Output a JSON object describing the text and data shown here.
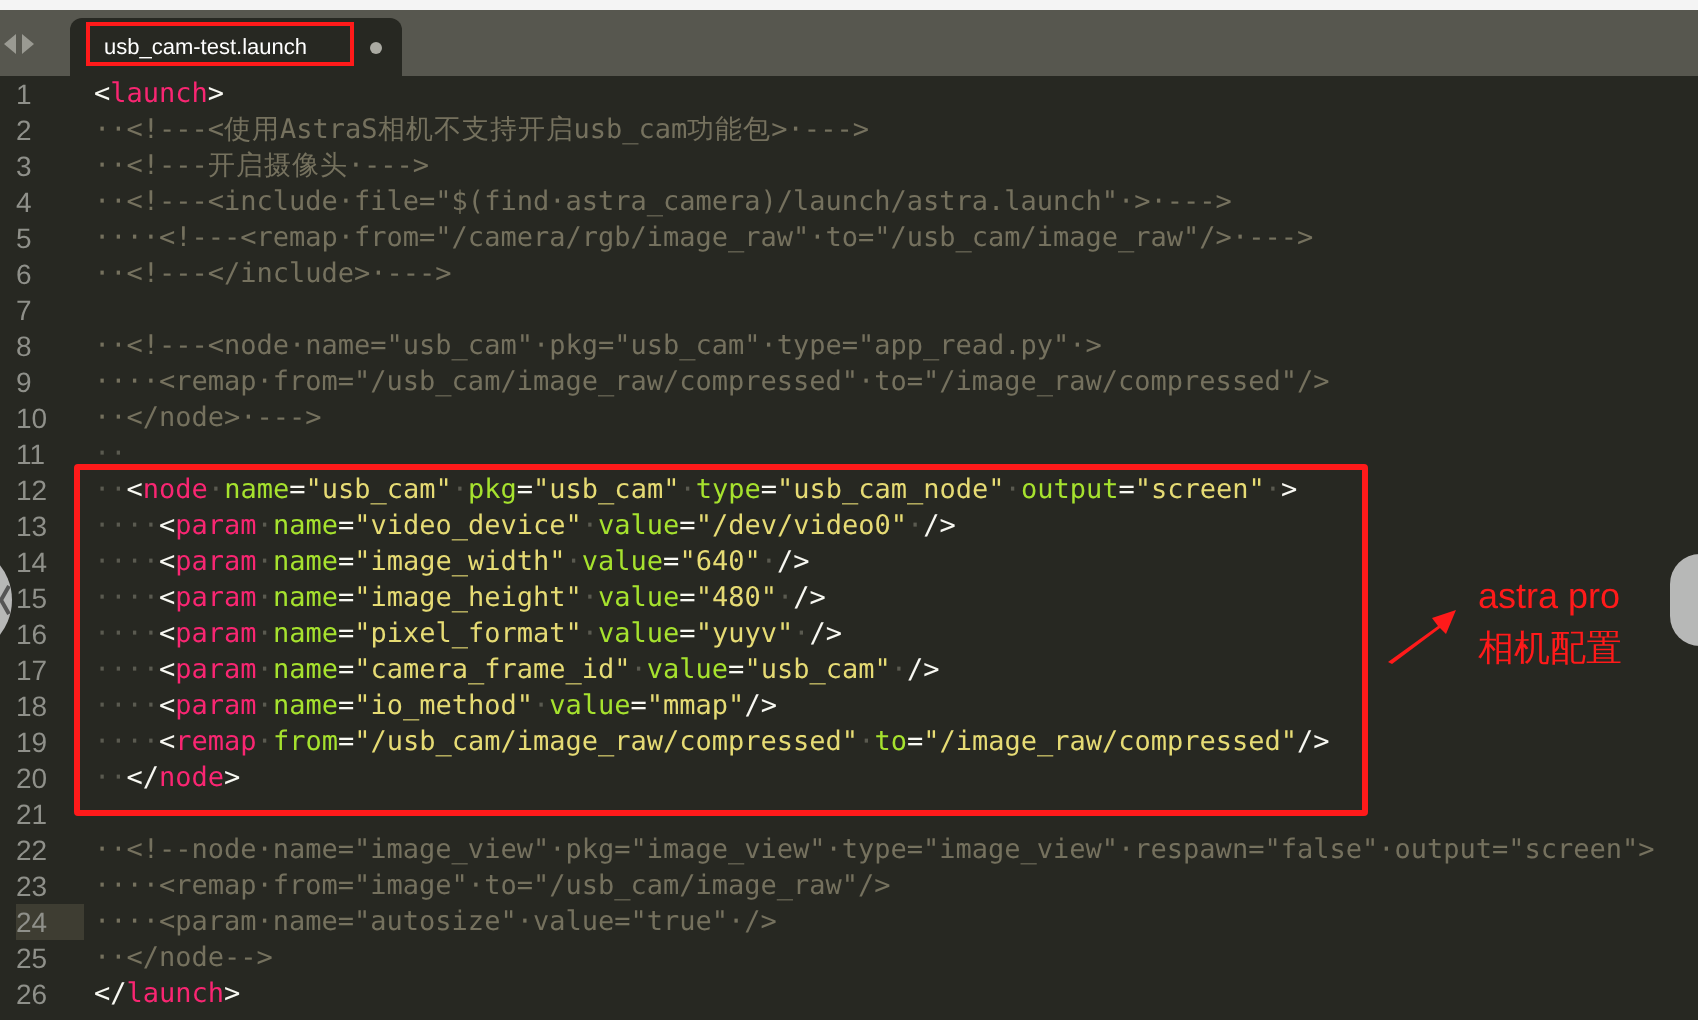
{
  "tab": {
    "label": "usb_cam-test.launch"
  },
  "lines": [
    {
      "number": "1",
      "current": false,
      "tokens": [
        {
          "kind": "punct",
          "text": "<"
        },
        {
          "kind": "tag",
          "text": "launch"
        },
        {
          "kind": "punct",
          "text": ">"
        }
      ]
    },
    {
      "number": "2",
      "current": false,
      "tokens": [
        {
          "kind": "comment",
          "text": "··<!---<使用AstraS相机不支持开启usb_cam功能包>·--->"
        }
      ]
    },
    {
      "number": "3",
      "current": false,
      "tokens": [
        {
          "kind": "comment",
          "text": "··<!---开启摄像头·--->"
        }
      ]
    },
    {
      "number": "4",
      "current": false,
      "tokens": [
        {
          "kind": "comment",
          "text": "··<!---<include·file=\"$(find·astra_camera)/launch/astra.launch\"·>·--->"
        }
      ]
    },
    {
      "number": "5",
      "current": false,
      "tokens": [
        {
          "kind": "comment",
          "text": "····<!---<remap·from=\"/camera/rgb/image_raw\"·to=\"/usb_cam/image_raw\"/>·--->"
        }
      ]
    },
    {
      "number": "6",
      "current": false,
      "tokens": [
        {
          "kind": "comment",
          "text": "··<!---</include>·--->"
        }
      ]
    },
    {
      "number": "7",
      "current": false
    },
    {
      "number": "8",
      "current": false,
      "tokens": [
        {
          "kind": "comment",
          "text": "··<!---<node·name=\"usb_cam\"·pkg=\"usb_cam\"·type=\"app_read.py\"·>"
        }
      ]
    },
    {
      "number": "9",
      "current": false,
      "tokens": [
        {
          "kind": "comment",
          "text": "····<remap·from=\"/usb_cam/image_raw/compressed\"·to=\"/image_raw/compressed\"/>"
        }
      ]
    },
    {
      "number": "10",
      "current": false,
      "tokens": [
        {
          "kind": "comment",
          "text": "··</node>·--->"
        }
      ]
    },
    {
      "number": "11",
      "current": false,
      "tokens": [
        {
          "kind": "space",
          "text": "··"
        }
      ]
    },
    {
      "number": "12",
      "current": false,
      "tokens": [
        {
          "kind": "space",
          "text": "··"
        },
        {
          "kind": "punct",
          "text": "<"
        },
        {
          "kind": "tag",
          "text": "node"
        },
        {
          "kind": "space",
          "text": "·"
        },
        {
          "kind": "attr",
          "text": "name"
        },
        {
          "kind": "punct",
          "text": "="
        },
        {
          "kind": "string",
          "text": "\"usb_cam\""
        },
        {
          "kind": "space",
          "text": "·"
        },
        {
          "kind": "attr",
          "text": "pkg"
        },
        {
          "kind": "punct",
          "text": "="
        },
        {
          "kind": "string",
          "text": "\"usb_cam\""
        },
        {
          "kind": "space",
          "text": "·"
        },
        {
          "kind": "attr",
          "text": "type"
        },
        {
          "kind": "punct",
          "text": "="
        },
        {
          "kind": "string",
          "text": "\"usb_cam_node\""
        },
        {
          "kind": "space",
          "text": "·"
        },
        {
          "kind": "attr",
          "text": "output"
        },
        {
          "kind": "punct",
          "text": "="
        },
        {
          "kind": "string",
          "text": "\"screen\""
        },
        {
          "kind": "space",
          "text": "·"
        },
        {
          "kind": "punct",
          "text": ">"
        }
      ]
    },
    {
      "number": "13",
      "current": false,
      "tokens": [
        {
          "kind": "space",
          "text": "····"
        },
        {
          "kind": "punct",
          "text": "<"
        },
        {
          "kind": "tag",
          "text": "param"
        },
        {
          "kind": "space",
          "text": "·"
        },
        {
          "kind": "attr",
          "text": "name"
        },
        {
          "kind": "punct",
          "text": "="
        },
        {
          "kind": "string",
          "text": "\"video_device\""
        },
        {
          "kind": "space",
          "text": "·"
        },
        {
          "kind": "attr",
          "text": "value"
        },
        {
          "kind": "punct",
          "text": "="
        },
        {
          "kind": "string",
          "text": "\"/dev/video0\""
        },
        {
          "kind": "space",
          "text": "·"
        },
        {
          "kind": "punct",
          "text": "/>"
        }
      ]
    },
    {
      "number": "14",
      "current": false,
      "tokens": [
        {
          "kind": "space",
          "text": "····"
        },
        {
          "kind": "punct",
          "text": "<"
        },
        {
          "kind": "tag",
          "text": "param"
        },
        {
          "kind": "space",
          "text": "·"
        },
        {
          "kind": "attr",
          "text": "name"
        },
        {
          "kind": "punct",
          "text": "="
        },
        {
          "kind": "string",
          "text": "\"image_width\""
        },
        {
          "kind": "space",
          "text": "·"
        },
        {
          "kind": "attr",
          "text": "value"
        },
        {
          "kind": "punct",
          "text": "="
        },
        {
          "kind": "string",
          "text": "\"640\""
        },
        {
          "kind": "space",
          "text": "·"
        },
        {
          "kind": "punct",
          "text": "/>"
        }
      ]
    },
    {
      "number": "15",
      "current": false,
      "tokens": [
        {
          "kind": "space",
          "text": "····"
        },
        {
          "kind": "punct",
          "text": "<"
        },
        {
          "kind": "tag",
          "text": "param"
        },
        {
          "kind": "space",
          "text": "·"
        },
        {
          "kind": "attr",
          "text": "name"
        },
        {
          "kind": "punct",
          "text": "="
        },
        {
          "kind": "string",
          "text": "\"image_height\""
        },
        {
          "kind": "space",
          "text": "·"
        },
        {
          "kind": "attr",
          "text": "value"
        },
        {
          "kind": "punct",
          "text": "="
        },
        {
          "kind": "string",
          "text": "\"480\""
        },
        {
          "kind": "space",
          "text": "·"
        },
        {
          "kind": "punct",
          "text": "/>"
        }
      ]
    },
    {
      "number": "16",
      "current": false,
      "tokens": [
        {
          "kind": "space",
          "text": "····"
        },
        {
          "kind": "punct",
          "text": "<"
        },
        {
          "kind": "tag",
          "text": "param"
        },
        {
          "kind": "space",
          "text": "·"
        },
        {
          "kind": "attr",
          "text": "name"
        },
        {
          "kind": "punct",
          "text": "="
        },
        {
          "kind": "string",
          "text": "\"pixel_format\""
        },
        {
          "kind": "space",
          "text": "·"
        },
        {
          "kind": "attr",
          "text": "value"
        },
        {
          "kind": "punct",
          "text": "="
        },
        {
          "kind": "string",
          "text": "\"yuyv\""
        },
        {
          "kind": "space",
          "text": "·"
        },
        {
          "kind": "punct",
          "text": "/>"
        }
      ]
    },
    {
      "number": "17",
      "current": false,
      "tokens": [
        {
          "kind": "space",
          "text": "····"
        },
        {
          "kind": "punct",
          "text": "<"
        },
        {
          "kind": "tag",
          "text": "param"
        },
        {
          "kind": "space",
          "text": "·"
        },
        {
          "kind": "attr",
          "text": "name"
        },
        {
          "kind": "punct",
          "text": "="
        },
        {
          "kind": "string",
          "text": "\"camera_frame_id\""
        },
        {
          "kind": "space",
          "text": "·"
        },
        {
          "kind": "attr",
          "text": "value"
        },
        {
          "kind": "punct",
          "text": "="
        },
        {
          "kind": "string",
          "text": "\"usb_cam\""
        },
        {
          "kind": "space",
          "text": "·"
        },
        {
          "kind": "punct",
          "text": "/>"
        }
      ]
    },
    {
      "number": "18",
      "current": false,
      "tokens": [
        {
          "kind": "space",
          "text": "····"
        },
        {
          "kind": "punct",
          "text": "<"
        },
        {
          "kind": "tag",
          "text": "param"
        },
        {
          "kind": "space",
          "text": "·"
        },
        {
          "kind": "attr",
          "text": "name"
        },
        {
          "kind": "punct",
          "text": "="
        },
        {
          "kind": "string",
          "text": "\"io_method\""
        },
        {
          "kind": "space",
          "text": "·"
        },
        {
          "kind": "attr",
          "text": "value"
        },
        {
          "kind": "punct",
          "text": "="
        },
        {
          "kind": "string",
          "text": "\"mmap\""
        },
        {
          "kind": "punct",
          "text": "/>"
        }
      ]
    },
    {
      "number": "19",
      "current": false,
      "tokens": [
        {
          "kind": "space",
          "text": "····"
        },
        {
          "kind": "punct",
          "text": "<"
        },
        {
          "kind": "tag",
          "text": "remap"
        },
        {
          "kind": "space",
          "text": "·"
        },
        {
          "kind": "attr",
          "text": "from"
        },
        {
          "kind": "punct",
          "text": "="
        },
        {
          "kind": "string",
          "text": "\"/usb_cam/image_raw/compressed\""
        },
        {
          "kind": "space",
          "text": "·"
        },
        {
          "kind": "attr",
          "text": "to"
        },
        {
          "kind": "punct",
          "text": "="
        },
        {
          "kind": "string",
          "text": "\"/image_raw/compressed\""
        },
        {
          "kind": "punct",
          "text": "/>"
        }
      ]
    },
    {
      "number": "20",
      "current": false,
      "tokens": [
        {
          "kind": "space",
          "text": "··"
        },
        {
          "kind": "punct",
          "text": "</"
        },
        {
          "kind": "tag",
          "text": "node"
        },
        {
          "kind": "punct",
          "text": ">"
        }
      ]
    },
    {
      "number": "21",
      "current": false
    },
    {
      "number": "22",
      "current": false,
      "tokens": [
        {
          "kind": "comment",
          "text": "··<!--node·name=\"image_view\"·pkg=\"image_view\"·type=\"image_view\"·respawn=\"false\"·output=\"screen\">"
        }
      ]
    },
    {
      "number": "23",
      "current": false,
      "tokens": [
        {
          "kind": "comment",
          "text": "····<remap·from=\"image\"·to=\"/usb_cam/image_raw\"/>"
        }
      ]
    },
    {
      "number": "24",
      "current": true,
      "tokens": [
        {
          "kind": "comment",
          "text": "····<param·name=\"autosize\"·value=\"true\"·/>"
        }
      ]
    },
    {
      "number": "25",
      "current": false,
      "tokens": [
        {
          "kind": "comment",
          "text": "··</node-->"
        }
      ]
    },
    {
      "number": "26",
      "current": false,
      "tokens": [
        {
          "kind": "punct",
          "text": "</"
        },
        {
          "kind": "tag",
          "text": "launch"
        },
        {
          "kind": "punct",
          "text": ">"
        }
      ]
    }
  ],
  "annotation": {
    "lines": [
      "astra pro",
      "相机配置"
    ]
  }
}
